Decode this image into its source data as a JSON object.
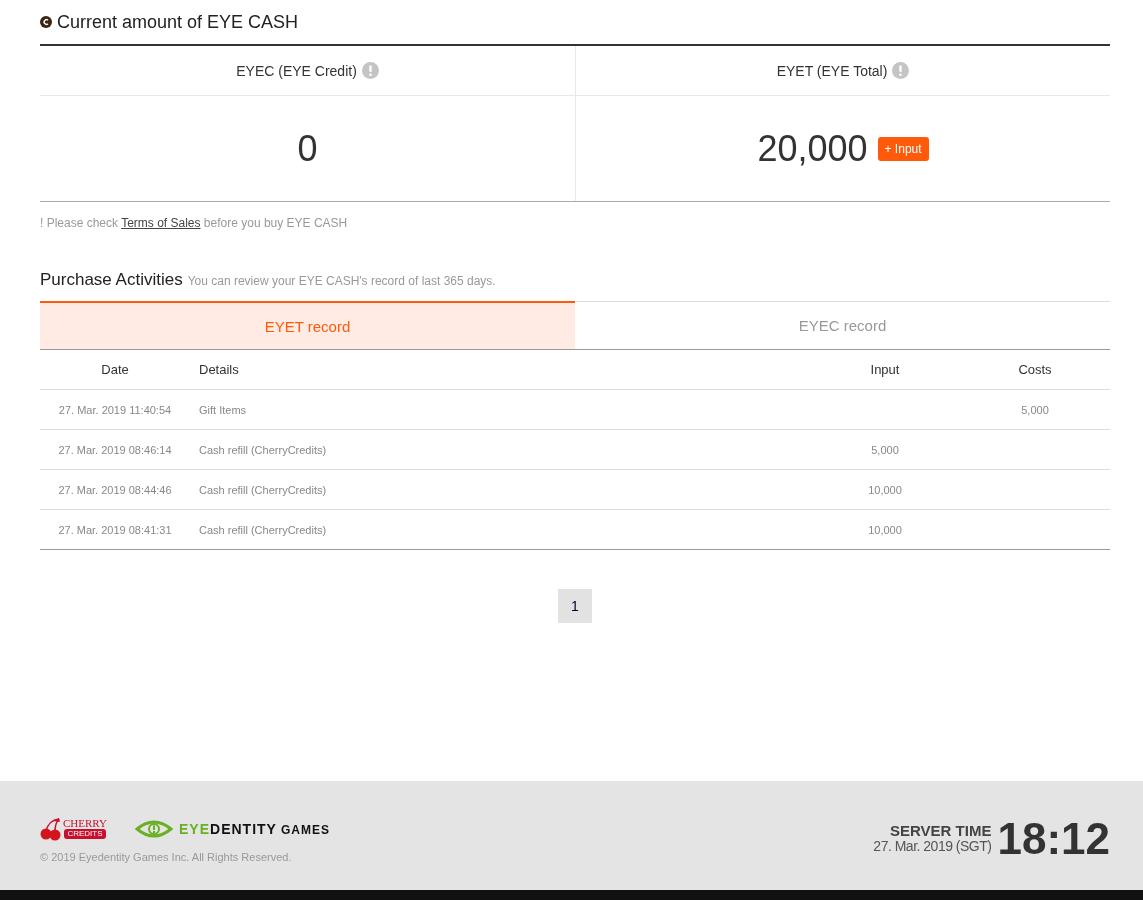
{
  "cash": {
    "title": "Current amount of EYE CASH",
    "balances": [
      {
        "label": "EYEC (EYE Credit)",
        "amount": "0"
      },
      {
        "label": "EYET (EYE Total)",
        "amount": "20,000",
        "button": "+ Input"
      }
    ],
    "notice": {
      "before": "! Please check",
      "link": "Terms of Sales",
      "after": "before you buy EYE CASH"
    }
  },
  "activities": {
    "title": "Purchase Activities",
    "subtitle": "You can review your EYE CASH's record of last 365 days.",
    "tabs": [
      {
        "label": "EYET record",
        "selected": true
      },
      {
        "label": "EYEC record",
        "selected": false
      }
    ],
    "table": {
      "columns": [
        "Date",
        "Details",
        "Input",
        "Costs"
      ],
      "rows": [
        [
          "27. Mar. 2019 11:40:54",
          "Gift Items",
          "",
          "5,000"
        ],
        [
          "27. Mar. 2019 08:46:14",
          "Cash refill (CherryCredits)",
          "5,000",
          ""
        ],
        [
          "27. Mar. 2019 08:44:46",
          "Cash refill (CherryCredits)",
          "10,000",
          ""
        ],
        [
          "27. Mar. 2019 08:41:31",
          "Cash refill (CherryCredits)",
          "10,000",
          ""
        ]
      ]
    },
    "pagination": [
      {
        "label": "1",
        "selected": true
      }
    ]
  },
  "footer": {
    "cherry_logo": {
      "word": "CHERRY",
      "tag": "CREDITS"
    },
    "eyedentity_logo": {
      "eye": "EYE",
      "dentity": "DENTITY",
      "games": "GAMES"
    },
    "copyright": "© 2019 Eyedentity Games Inc. All Rights Reserved.",
    "server_time": {
      "label": "SERVER TIME",
      "date": "27. Mar. 2019 (SGT)",
      "time": "18:12"
    }
  }
}
